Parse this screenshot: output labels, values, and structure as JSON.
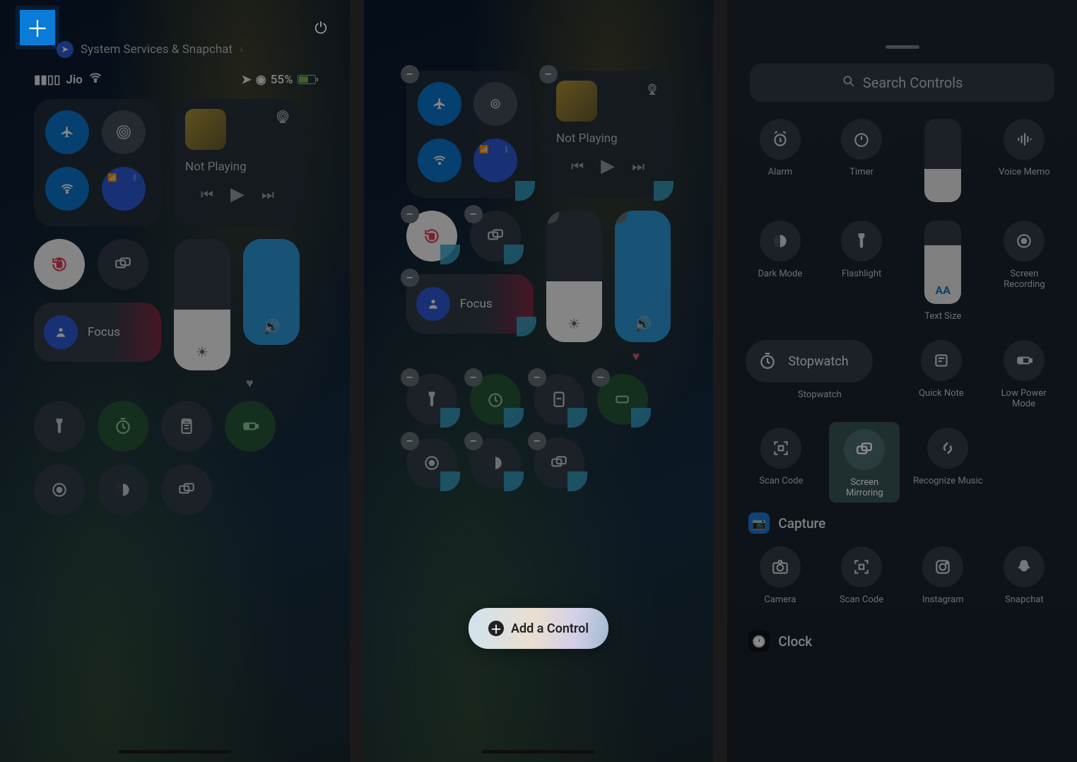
{
  "panel1": {
    "breadcrumb": "System Services & Snapchat",
    "carrier": "Jio",
    "battery": "55%",
    "not_playing": "Not Playing",
    "focus": "Focus"
  },
  "panel2": {
    "not_playing": "Not Playing",
    "focus": "Focus",
    "add_control": "Add a Control"
  },
  "panel3": {
    "search_placeholder": "Search Controls",
    "row1": {
      "alarm": "Alarm",
      "timer": "Timer",
      "voice": "Voice Memo"
    },
    "row2": {
      "dark": "Dark Mode",
      "flash": "Flashlight",
      "text": "Text Size",
      "rec": "Screen Recording"
    },
    "row3": {
      "stop": "Stopwatch",
      "note": "Quick Note",
      "low": "Low Power Mode"
    },
    "row4": {
      "scan": "Scan Code",
      "mirror": "Screen Mirroring",
      "music": "Recognize Music"
    },
    "stopwatch_label": "Stopwatch",
    "capture": "Capture",
    "row5": {
      "cam": "Camera",
      "scan2": "Scan Code",
      "ig": "Instagram",
      "snap": "Snapchat"
    },
    "clock": "Clock",
    "text_size_glyph": "AA"
  }
}
